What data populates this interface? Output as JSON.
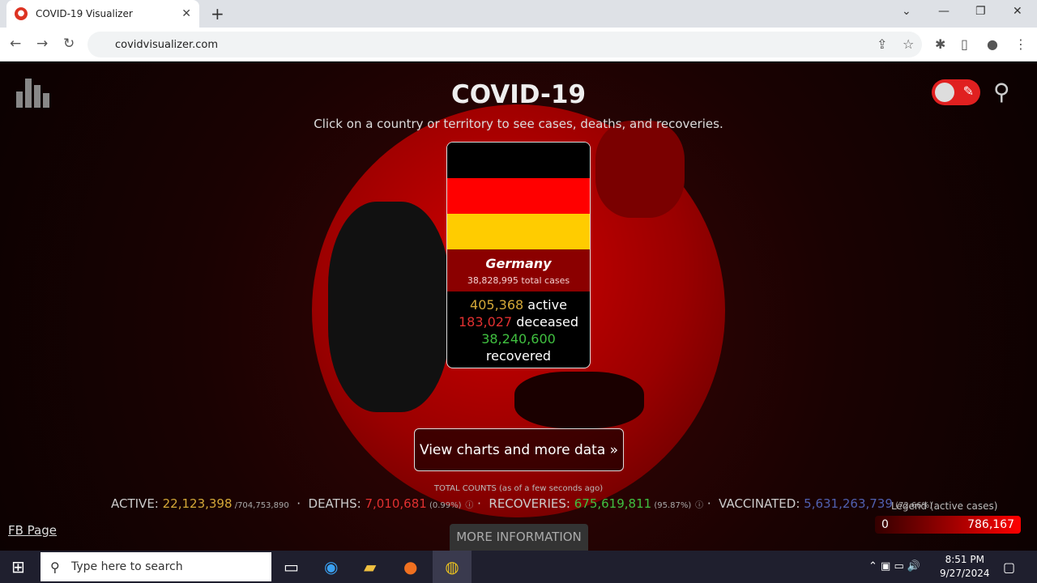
{
  "browser": {
    "tab_title": "COVID-19 Visualizer",
    "url": "covidvisualizer.com"
  },
  "page": {
    "title": "COVID-19",
    "subtitle": "Click on a country or territory to see cases, deaths, and recoveries.",
    "card": {
      "country": "Germany",
      "total": "38,828,995 total cases",
      "active": "405,368",
      "active_label": " active",
      "deceased": "183,027",
      "deceased_label": " deceased",
      "recovered": "38,240,600",
      "recovered_label": "recovered",
      "flag_colors": [
        "#000000",
        "#ff0000",
        "#ffcc00"
      ]
    },
    "more_button": "View charts and more data »",
    "totals_header": "TOTAL COUNTS (as of a few seconds ago)",
    "totals": {
      "active_label": "ACTIVE: ",
      "active": "22,123,398",
      "active_total": " /704,753,890",
      "deaths_label": "DEATHS: ",
      "deaths": "7,010,681",
      "deaths_pct": " (0.99%)",
      "recoveries_label": "RECOVERIES: ",
      "recoveries": "675,619,811",
      "recoveries_pct": " (95.87%)",
      "vaccinated_label": "VACCINATED: ",
      "vaccinated": "5,631,263,739",
      "vaccinated_pct": " (72.66%)"
    },
    "fb_link": "FB Page",
    "more_info": "MORE INFORMATION",
    "legend": {
      "title": "Legend (active cases)",
      "min": "0",
      "max": "786,167"
    },
    "colors": {
      "active": "#d4a838",
      "deaths": "#e03030",
      "recoveries": "#40c040",
      "vaccinated": "#5060b0",
      "accent": "#e02020"
    }
  },
  "taskbar": {
    "search_placeholder": "Type here to search",
    "time": "8:51 PM",
    "date": "9/27/2024"
  }
}
